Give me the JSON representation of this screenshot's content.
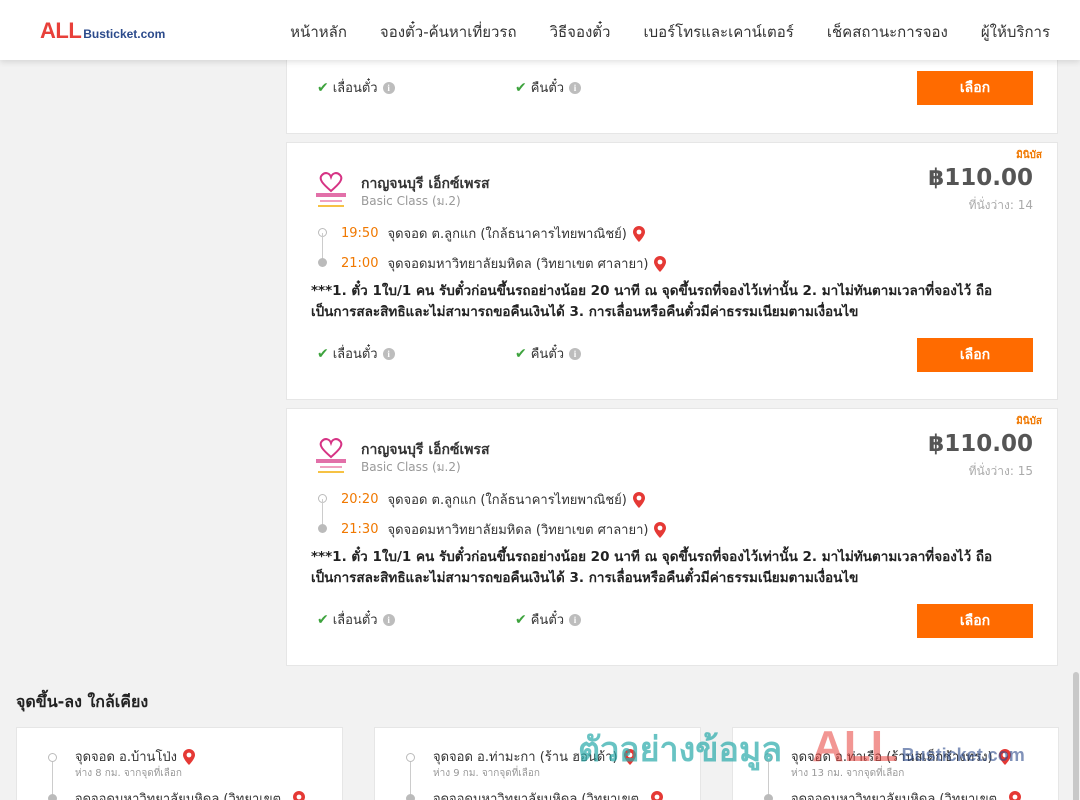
{
  "brand": {
    "all": "ALL",
    "rest": "Busticket.com"
  },
  "nav": [
    {
      "label": "หน้าหลัก"
    },
    {
      "label": "จองตั๋ว-ค้นหาเที่ยวรถ"
    },
    {
      "label": "วิธีจองตั๋ว"
    },
    {
      "label": "เบอร์โทรและเคาน์เตอร์"
    },
    {
      "label": "เช็คสถานะการจอง"
    },
    {
      "label": "ผู้ให้บริการ"
    }
  ],
  "features": {
    "reschedule": "เลื่อนตั๋ว",
    "refund": "คืนตั๋ว",
    "select_button": "เลือก",
    "info_glyph": "i"
  },
  "trips": [
    {
      "badge": "มินิบัส",
      "operator": "กาญจนบุรี เอ็กซ์เพรส",
      "bus_class": "Basic Class (ม.2)",
      "price": "฿110.00",
      "seats": "ที่นั่งว่าง: 14",
      "depart_time": "19:50",
      "depart_stop": "จุดจอด ต.ลูกแก (ใกล้ธนาคารไทยพาณิชย์)",
      "arrive_time": "21:00",
      "arrive_stop": "จุดจอดมหาวิทยาลัยมหิดล (วิทยาเขต ศาลายา)",
      "note": "***1. ตั๋ว 1ใบ/1 คน รับตั๋วก่อนขึ้นรถอย่างน้อย 20 นาที ณ จุดขึ้นรถที่จองไว้เท่านั้น 2. มาไม่ทันตามเวลาที่จองไว้ ถือเป็นการสละสิทธิและไม่สามารถขอคืนเงินได้ 3. การเลื่อนหรือคืนตั๋วมีค่าธรรมเนียมตามเงื่อนไข"
    },
    {
      "badge": "มินิบัส",
      "operator": "กาญจนบุรี เอ็กซ์เพรส",
      "bus_class": "Basic Class (ม.2)",
      "price": "฿110.00",
      "seats": "ที่นั่งว่าง: 15",
      "depart_time": "20:20",
      "depart_stop": "จุดจอด ต.ลูกแก (ใกล้ธนาคารไทยพาณิชย์)",
      "arrive_time": "21:30",
      "arrive_stop": "จุดจอดมหาวิทยาลัยมหิดล (วิทยาเขต ศาลายา)",
      "note": "***1. ตั๋ว 1ใบ/1 คน รับตั๋วก่อนขึ้นรถอย่างน้อย 20 นาที ณ จุดขึ้นรถที่จองไว้เท่านั้น 2. มาไม่ทันตามเวลาที่จองไว้ ถือเป็นการสละสิทธิและไม่สามารถขอคืนเงินได้ 3. การเลื่อนหรือคืนตั๋วมีค่าธรรมเนียมตามเงื่อนไข"
    }
  ],
  "nearby": {
    "title": "จุดขึ้น-ลง ใกล้เคียง",
    "items": [
      {
        "name": "จุดจอด อ.บ้านโป่ง",
        "distance": "ห่าง 8 กม. จากจุดที่เลือก",
        "dest": "จุดจอดมหาวิทยาลัยมหิดล (วิทยาเขต"
      },
      {
        "name": "จุดจอด อ.ท่ามะกา (ร้าน ฮอนด้า)",
        "distance": "ห่าง 9 กม. จากจุดที่เลือก",
        "dest": "จุดจอดมหาวิทยาลัยมหิดล (วิทยาเขต"
      },
      {
        "name": "จุดจอด อ.ท่าเรือ (ร้านสเต็กช้างทรง)",
        "distance": "ห่าง 13 กม. จากจุดที่เลือก",
        "dest": "จุดจอดมหาวิทยาลัยมหิดล (วิทยาเขต"
      }
    ]
  },
  "watermark": {
    "thai": "ตัวอย่างข้อมูล",
    "all": "ALL",
    "rest": "Busticket.com"
  },
  "colors": {
    "accent": "#ff6b00",
    "time": "#f07800",
    "check": "#3ea33e",
    "pin": "#e53935"
  }
}
